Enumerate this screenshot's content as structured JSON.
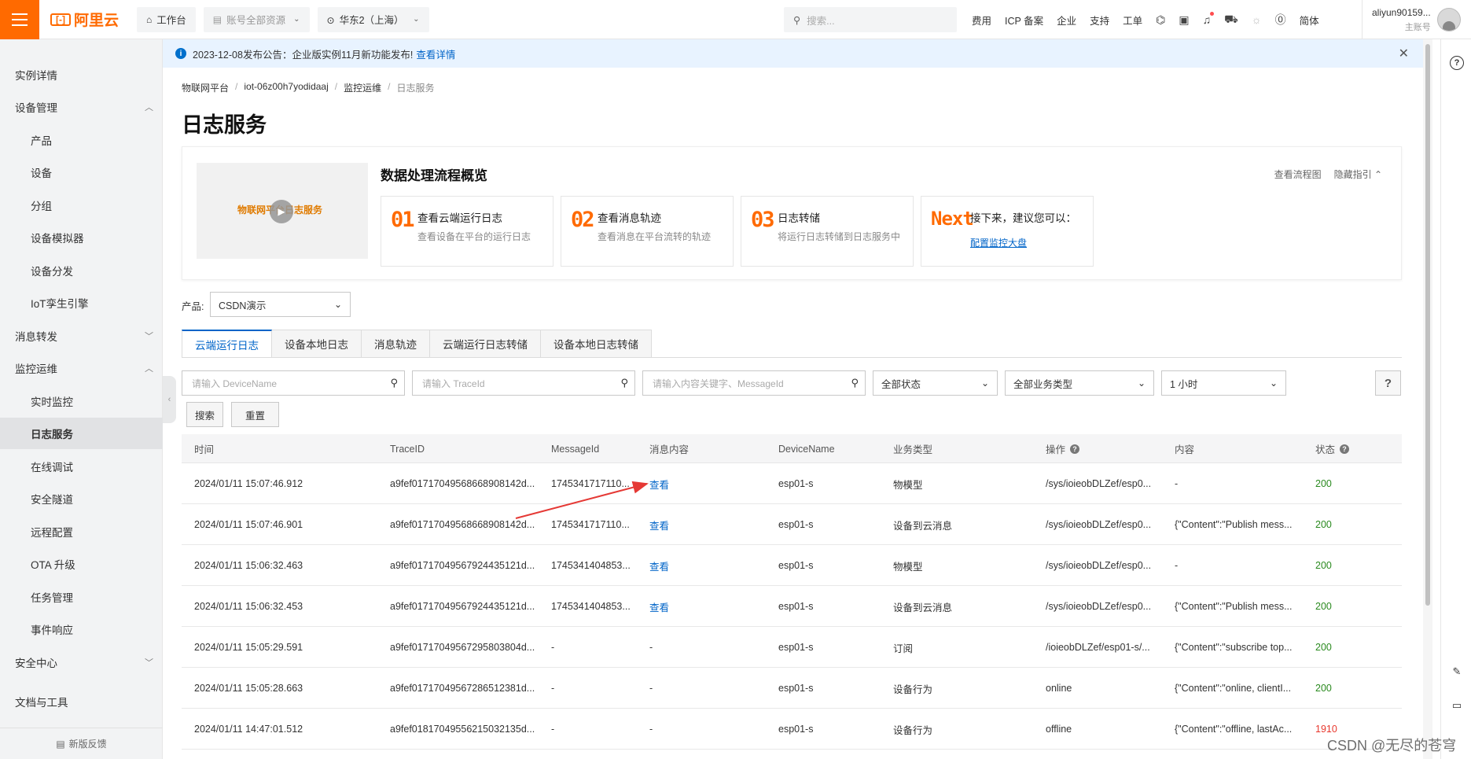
{
  "topbar": {
    "logo_text": "阿里云",
    "workbench": "工作台",
    "resources": "账号全部资源",
    "region": "华东2（上海）",
    "search_placeholder": "搜索...",
    "links": [
      "费用",
      "ICP 备案",
      "企业",
      "支持",
      "工单"
    ],
    "lang": "简体",
    "account_name": "aliyun90159...",
    "account_type": "主账号"
  },
  "notice": {
    "text": "2023-12-08发布公告：企业版实例11月新功能发布!",
    "link": "查看详情"
  },
  "sidebar": {
    "items": [
      {
        "label": "实例详情",
        "level": 1
      },
      {
        "label": "设备管理",
        "level": 1,
        "expanded": true
      },
      {
        "label": "产品",
        "level": 2
      },
      {
        "label": "设备",
        "level": 2
      },
      {
        "label": "分组",
        "level": 2
      },
      {
        "label": "设备模拟器",
        "level": 2
      },
      {
        "label": "设备分发",
        "level": 2
      },
      {
        "label": "IoT孪生引擎",
        "level": 2
      },
      {
        "label": "消息转发",
        "level": 1,
        "expanded": false
      },
      {
        "label": "监控运维",
        "level": 1,
        "expanded": true
      },
      {
        "label": "实时监控",
        "level": 2
      },
      {
        "label": "日志服务",
        "level": 2,
        "active": true
      },
      {
        "label": "在线调试",
        "level": 2
      },
      {
        "label": "安全隧道",
        "level": 2
      },
      {
        "label": "远程配置",
        "level": 2
      },
      {
        "label": "OTA 升级",
        "level": 2
      },
      {
        "label": "任务管理",
        "level": 2
      },
      {
        "label": "事件响应",
        "level": 2
      },
      {
        "label": "安全中心",
        "level": 1,
        "expanded": false
      },
      {
        "label": "文档与工具",
        "level": 1
      }
    ],
    "feedback": "新版反馈"
  },
  "breadcrumb": [
    "物联网平台",
    "iot-06z00h7yodidaaj",
    "监控运维",
    "日志服务"
  ],
  "page_title": "日志服务",
  "guide": {
    "video_text": "物联网平台日志服务",
    "title": "数据处理流程概览",
    "view_flow": "查看流程图",
    "hide_guide": "隐藏指引",
    "steps": [
      {
        "num": "01",
        "title": "查看云端运行日志",
        "desc": "查看设备在平台的运行日志"
      },
      {
        "num": "02",
        "title": "查看消息轨迹",
        "desc": "查看消息在平台流转的轨迹"
      },
      {
        "num": "03",
        "title": "日志转储",
        "desc": "将运行日志转储到日志服务中"
      },
      {
        "num": "Next",
        "title": "接下来，建议您可以：",
        "link": "配置监控大盘"
      }
    ]
  },
  "filters": {
    "product_label": "产品:",
    "product_value": "CSDN演示",
    "device_placeholder": "请输入 DeviceName",
    "trace_placeholder": "请输入 TraceId",
    "content_placeholder": "请输入内容关键字、MessageId",
    "status_value": "全部状态",
    "biz_value": "全部业务类型",
    "time_value": "1 小时",
    "search_btn": "搜索",
    "reset_btn": "重置",
    "help": "?"
  },
  "tabs": [
    "云端运行日志",
    "设备本地日志",
    "消息轨迹",
    "云端运行日志转储",
    "设备本地日志转储"
  ],
  "table": {
    "columns": [
      "时间",
      "TraceID",
      "MessageId",
      "消息内容",
      "DeviceName",
      "业务类型",
      "操作",
      "内容",
      "状态"
    ],
    "rows": [
      {
        "time": "2024/01/11 15:07:46.912",
        "trace": "a9fef01717049568668908142d...",
        "msgid": "1745341717110...",
        "content": "查看",
        "device": "esp01-s",
        "biz": "物模型",
        "op": "/sys/ioieobDLZef/esp0...",
        "body": "-",
        "status": "200"
      },
      {
        "time": "2024/01/11 15:07:46.901",
        "trace": "a9fef01717049568668908142d...",
        "msgid": "1745341717110...",
        "content": "查看",
        "device": "esp01-s",
        "biz": "设备到云消息",
        "op": "/sys/ioieobDLZef/esp0...",
        "body": "{\"Content\":\"Publish mess...",
        "status": "200"
      },
      {
        "time": "2024/01/11 15:06:32.463",
        "trace": "a9fef01717049567924435121d...",
        "msgid": "1745341404853...",
        "content": "查看",
        "device": "esp01-s",
        "biz": "物模型",
        "op": "/sys/ioieobDLZef/esp0...",
        "body": "-",
        "status": "200"
      },
      {
        "time": "2024/01/11 15:06:32.453",
        "trace": "a9fef01717049567924435121d...",
        "msgid": "1745341404853...",
        "content": "查看",
        "device": "esp01-s",
        "biz": "设备到云消息",
        "op": "/sys/ioieobDLZef/esp0...",
        "body": "{\"Content\":\"Publish mess...",
        "status": "200"
      },
      {
        "time": "2024/01/11 15:05:29.591",
        "trace": "a9fef01717049567295803804d...",
        "msgid": "-",
        "content": "-",
        "device": "esp01-s",
        "biz": "订阅",
        "op": "/ioieobDLZef/esp01-s/...",
        "body": "{\"Content\":\"subscribe top...",
        "status": "200"
      },
      {
        "time": "2024/01/11 15:05:28.663",
        "trace": "a9fef01717049567286512381d...",
        "msgid": "-",
        "content": "-",
        "device": "esp01-s",
        "biz": "设备行为",
        "op": "online",
        "body": "{\"Content\":\"online, clientI...",
        "status": "200"
      },
      {
        "time": "2024/01/11 14:47:01.512",
        "trace": "a9fef01817049556215032135d...",
        "msgid": "-",
        "content": "-",
        "device": "esp01-s",
        "biz": "设备行为",
        "op": "offline",
        "body": "{\"Content\":\"offline, lastAc...",
        "status": "1910"
      }
    ]
  },
  "watermark": "CSDN @无尽的苍穹",
  "colors": {
    "accent": "#ff6a00",
    "link": "#0064c8",
    "ok": "#2a8a1f",
    "error": "#e8382d",
    "annotation_arrow": "#e53935"
  }
}
